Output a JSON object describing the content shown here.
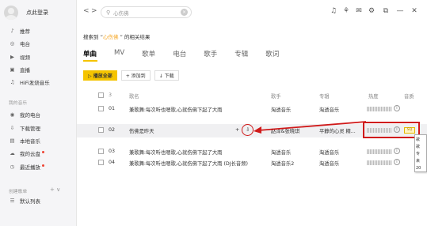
{
  "sidebar": {
    "login": "点此登录",
    "items_top": [
      {
        "icon": "music-note-icon",
        "glyph": "♪",
        "label": "推荐"
      },
      {
        "icon": "radio-icon",
        "glyph": "◎",
        "label": "电台"
      },
      {
        "icon": "video-icon",
        "glyph": "▶",
        "label": "视频"
      },
      {
        "icon": "live-icon",
        "glyph": "▣",
        "label": "直播"
      },
      {
        "icon": "hifi-icon",
        "glyph": "♫",
        "label": "HiFi发烧音乐"
      }
    ],
    "section_mine": "我的音乐",
    "items_mine": [
      {
        "icon": "my-radio-icon",
        "glyph": "◉",
        "label": "我的电台"
      },
      {
        "icon": "download-manager-icon",
        "glyph": "⇩",
        "label": "下载管理"
      },
      {
        "icon": "local-music-icon",
        "glyph": "▤",
        "label": "本地音乐"
      },
      {
        "icon": "cloud-disk-icon",
        "glyph": "☁",
        "label": "我的云盘"
      },
      {
        "icon": "recent-play-icon",
        "glyph": "◷",
        "label": "最近播放"
      }
    ],
    "section_playlists": "创建歌单",
    "playlist_tools": "+ ∨",
    "default_list": "默认列表"
  },
  "topbar": {
    "back_glyph": "<",
    "forward_glyph": ">",
    "search_value": "心伤佛",
    "clear_glyph": "×",
    "icons": [
      {
        "name": "headphones-icon",
        "glyph": "♫"
      },
      {
        "name": "shirt-icon",
        "glyph": "⚘"
      },
      {
        "name": "mail-icon",
        "glyph": "✉"
      },
      {
        "name": "settings-icon",
        "glyph": "⚙"
      },
      {
        "name": "mini-mode-icon",
        "glyph": "⧉"
      },
      {
        "name": "minimize-icon",
        "glyph": "—"
      },
      {
        "name": "close-icon",
        "glyph": "✕"
      }
    ]
  },
  "result": {
    "prefix": "搜索到 “",
    "query": "心伤佛",
    "suffix": " ” 的相关结果"
  },
  "tabs": [
    "单曲",
    "MV",
    "歌单",
    "电台",
    "歌手",
    "专辑",
    "歌词"
  ],
  "actions": {
    "play_all": "▷ 播放全部",
    "add_to": "+ 添加到",
    "download": "↓ 下载"
  },
  "table": {
    "header": {
      "index": "3",
      "song": "歌名",
      "artist": "歌手",
      "album": "专辑",
      "hot": "热度",
      "quality": "音质"
    },
    "rows": [
      {
        "index": "01",
        "song": "兼歌舞:每次听也嗯歌,心就伤佛下起了大雨",
        "artist": "淘透音乐",
        "album": "淘透音乐",
        "quality": ""
      },
      {
        "index": "02",
        "song": "伤佛是昨天",
        "artist": "赵泽&张晓琪",
        "album": "平静的心灵 精...",
        "quality": "SQ"
      },
      {
        "index": "03",
        "song": "兼歌舞:每次听也嗯歌,心就伤佛下起了大雨",
        "artist": "淘透音乐",
        "album": "淘透音乐",
        "quality": ""
      },
      {
        "index": "04",
        "song": "兼歌舞:每次听也嗯歌,心就伤佛下起了大雨 (DJ长音频)",
        "artist": "淘透音乐2",
        "album": "淘透音乐",
        "quality": ""
      }
    ]
  },
  "row_actions": {
    "add": "+",
    "download": "⇩"
  },
  "tooltip": "歌\n歌\n专\n来\n20"
}
